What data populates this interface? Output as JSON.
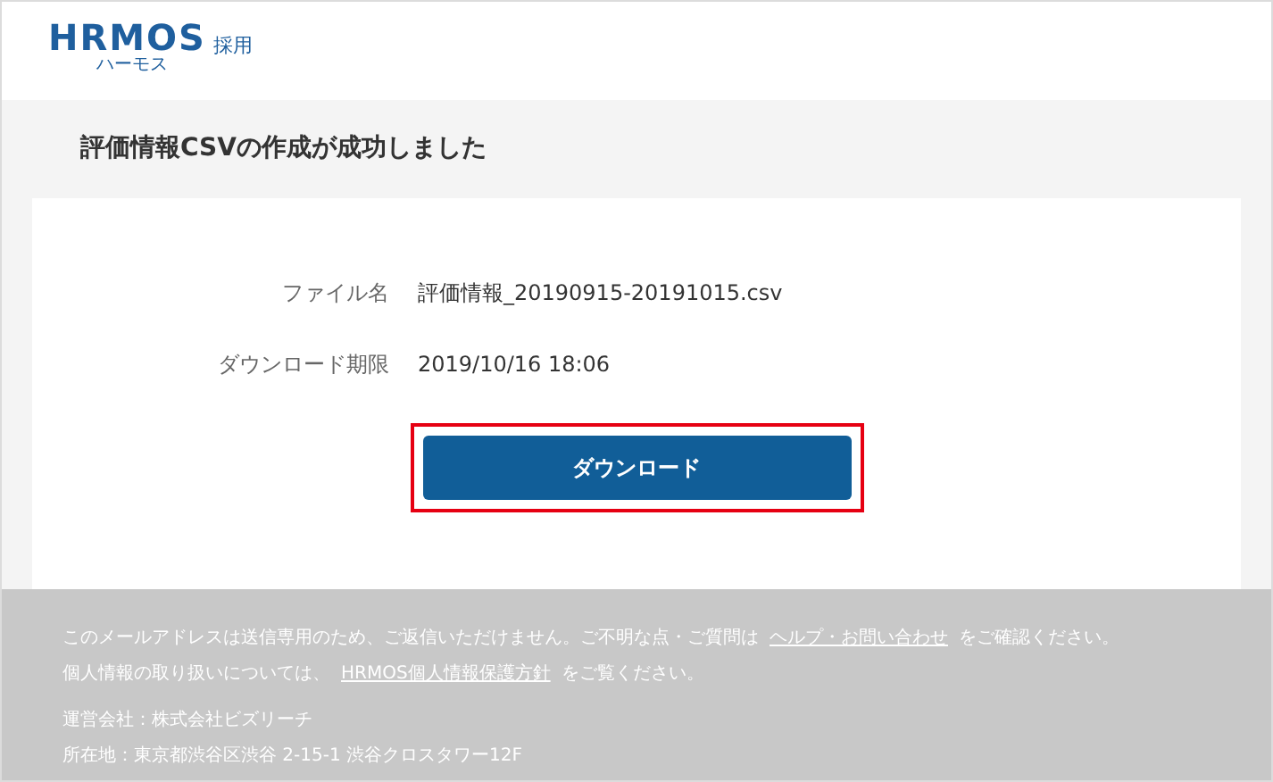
{
  "logo": {
    "wordmark": "HRMOS",
    "product": "採用",
    "reading": "ハーモス"
  },
  "title": "評価情報CSVの作成が成功しました",
  "details": [
    {
      "label": "ファイル名",
      "value": "評価情報_20190915-20191015.csv"
    },
    {
      "label": "ダウンロード期限",
      "value": "2019/10/16 18:06"
    }
  ],
  "download_button": {
    "label": "ダウンロード",
    "highlighted": true
  },
  "footer": {
    "notice": [
      {
        "before": "このメールアドレスは送信専用のため、ご返信いただけません。ご不明な点・ご質問は",
        "link": "ヘルプ・お問い合わせ",
        "after": "をご確認ください。"
      },
      {
        "before": "個人情報の取り扱いについては、",
        "link": "HRMOS個人情報保護方針",
        "after": "をご覧ください。"
      }
    ],
    "company": [
      "運営会社：株式会社ビズリーチ",
      "所在地：東京都渋谷区渋谷 2-15-1 渋谷クロスタワー12F"
    ]
  }
}
